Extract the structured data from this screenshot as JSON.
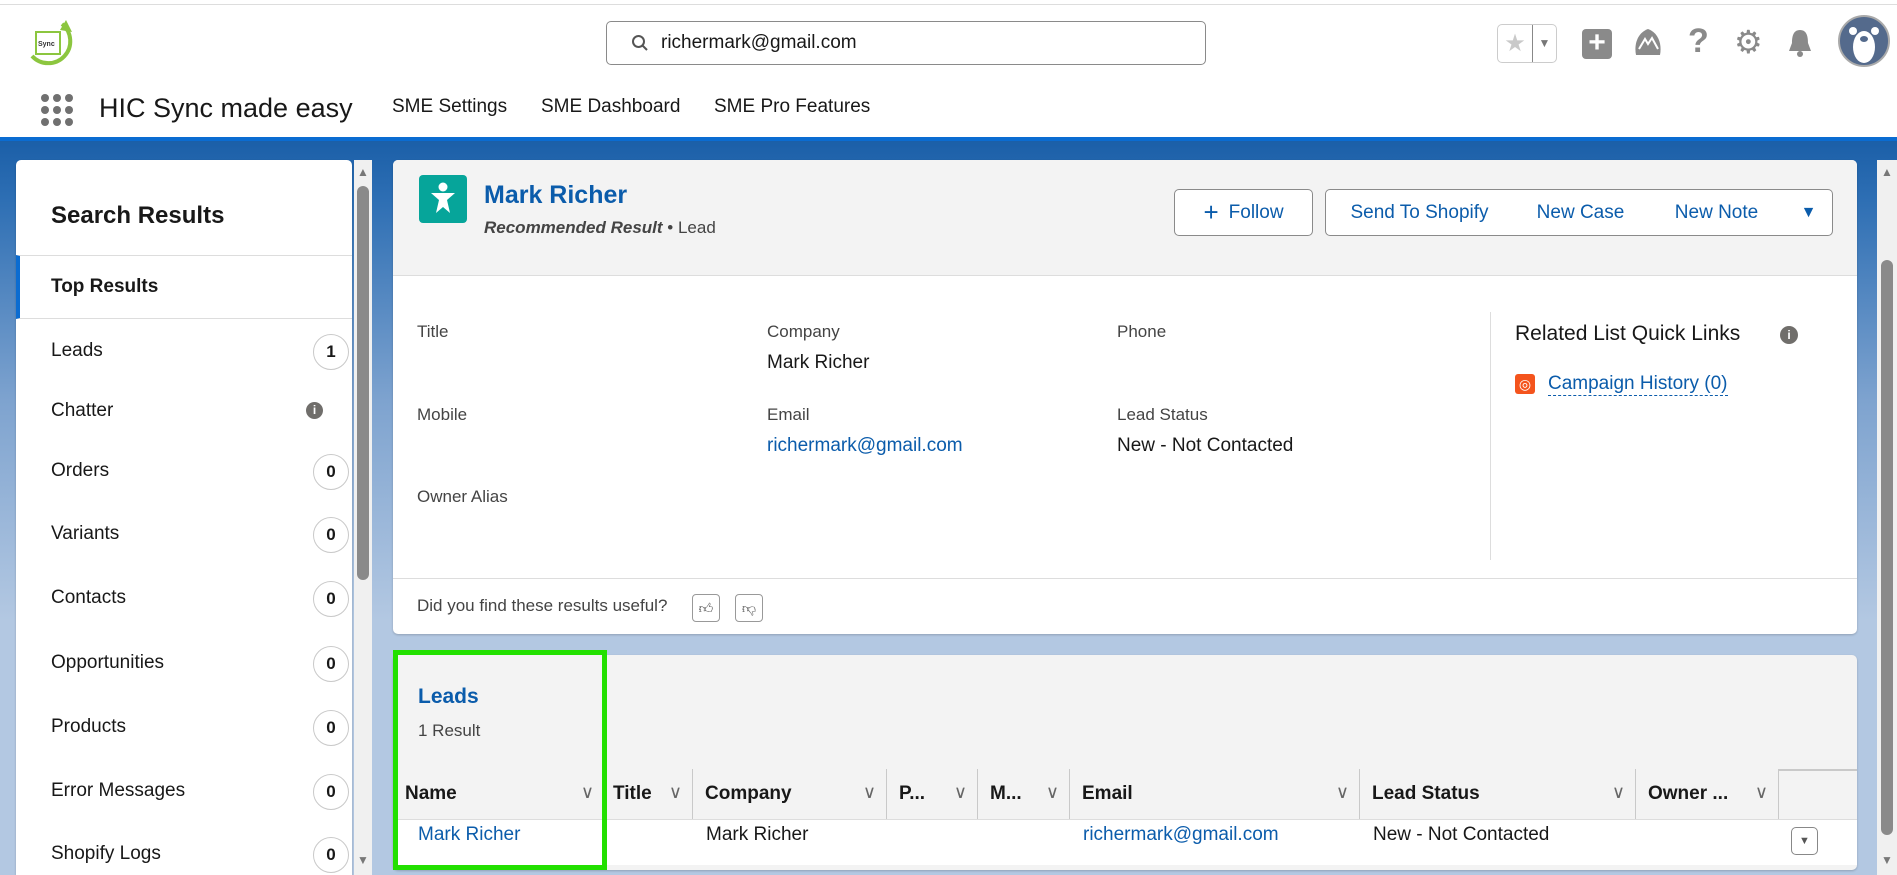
{
  "header": {
    "search_value": "richermark@gmail.com",
    "app_name": "HIC Sync made easy",
    "nav": [
      "SME Settings",
      "SME Dashboard",
      "SME Pro Features"
    ],
    "logo_text": "Sync made easy"
  },
  "sidebar": {
    "title": "Search Results",
    "top": "Top Results",
    "items": [
      {
        "label": "Leads",
        "count": "1"
      },
      {
        "label": "Chatter",
        "count": null
      },
      {
        "label": "Orders",
        "count": "0"
      },
      {
        "label": "Variants",
        "count": "0"
      },
      {
        "label": "Contacts",
        "count": "0"
      },
      {
        "label": "Opportunities",
        "count": "0"
      },
      {
        "label": "Products",
        "count": "0"
      },
      {
        "label": "Error Messages",
        "count": "0"
      },
      {
        "label": "Shopify Logs",
        "count": "0"
      }
    ]
  },
  "record": {
    "name": "Mark Richer",
    "recommended": "Recommended Result",
    "sep": "•",
    "type": "Lead",
    "buttons": {
      "follow": "Follow",
      "send": "Send To Shopify",
      "case": "New Case",
      "note": "New Note"
    },
    "fields": {
      "title_label": "Title",
      "company_label": "Company",
      "company": "Mark Richer",
      "phone_label": "Phone",
      "mobile_label": "Mobile",
      "email_label": "Email",
      "email": "richermark@gmail.com",
      "status_label": "Lead Status",
      "status": "New - Not Contacted",
      "owner_label": "Owner Alias"
    },
    "related_title": "Related List Quick Links",
    "campaign": "Campaign History (0)",
    "feedback": "Did you find these results useful?"
  },
  "leads": {
    "title": "Leads",
    "count": "1 Result",
    "columns": [
      "Name",
      "Title",
      "Company",
      "P...",
      "M...",
      "Email",
      "Lead Status",
      "Owner ..."
    ],
    "row": {
      "name": "Mark Richer",
      "company": "Mark Richer",
      "email": "richermark@gmail.com",
      "status": "New - Not Contacted"
    }
  },
  "colors": {
    "brand_blue": "#0b5cab",
    "highlight": "#22e000"
  }
}
